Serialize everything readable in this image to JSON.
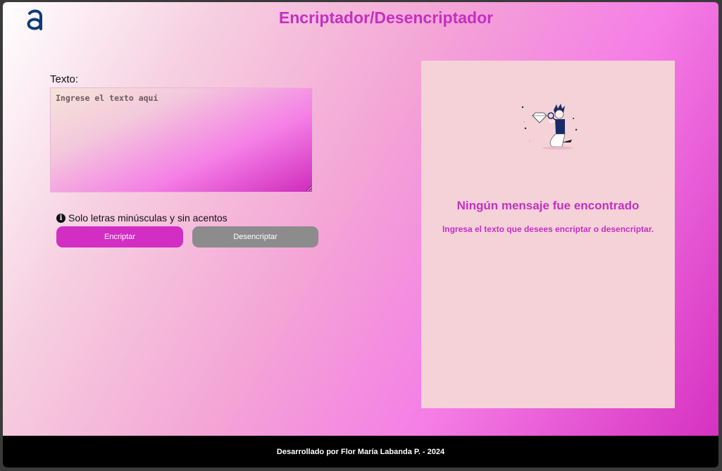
{
  "header": {
    "logo_icon": "alura-logo-icon",
    "title": "Encriptador/Desencriptador"
  },
  "input": {
    "label": "Texto:",
    "placeholder": "Ingrese el texto aquí",
    "value": ""
  },
  "hint": {
    "icon": "info-circle-icon",
    "text": "Solo letras minúsculas y sin acentos"
  },
  "buttons": {
    "encrypt_label": "Encriptar",
    "decrypt_label": "Desencriptar"
  },
  "output": {
    "illustration": "person-with-magnifier-illustration",
    "title": "Ningún mensaje fue encontrado",
    "subtitle": "Ingresa el texto que desees encriptar o desencriptar."
  },
  "footer": {
    "text": "Desarrollado por Flor María Labanda P. - 2024"
  },
  "colors": {
    "accent": "#c62fc1",
    "encrypt_button": "#d22ec3",
    "decrypt_button": "#8c8c8c",
    "panel": "#f4d2d8",
    "footer": "#000000"
  }
}
